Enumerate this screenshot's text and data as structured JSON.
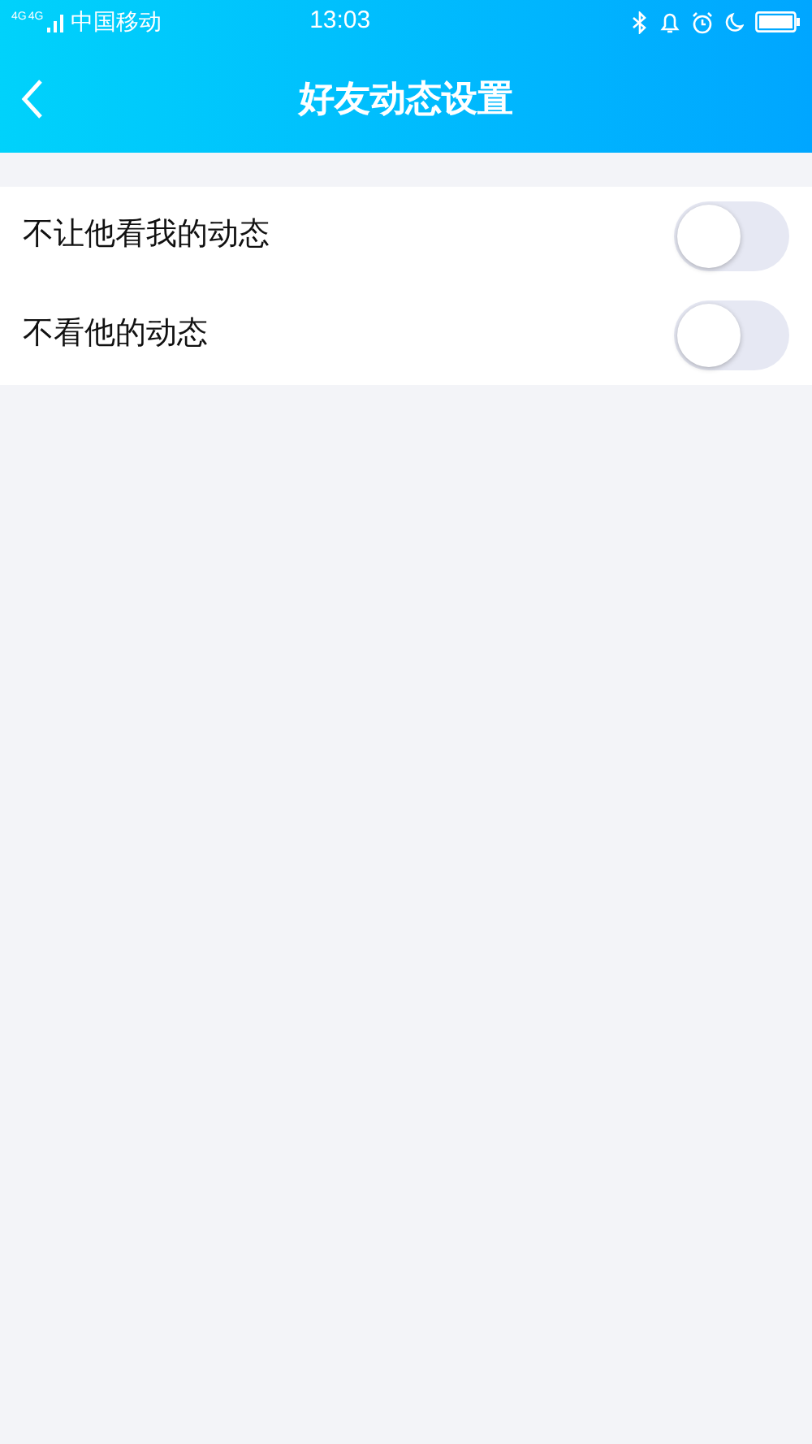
{
  "status_bar": {
    "networks": [
      "4G",
      "4G"
    ],
    "carrier": "中国移动",
    "time": "13:03"
  },
  "header": {
    "title": "好友动态设置"
  },
  "settings": [
    {
      "label": "不让他看我的动态",
      "on": false
    },
    {
      "label": "不看他的动态",
      "on": false
    }
  ]
}
